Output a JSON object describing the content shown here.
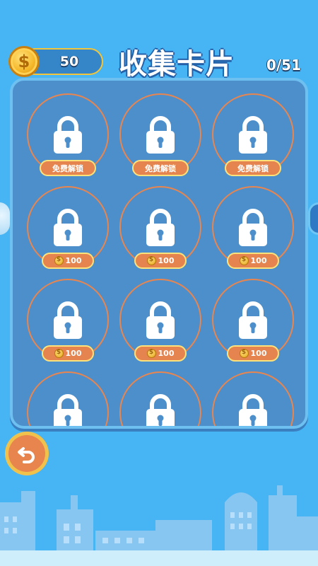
{
  "header": {
    "coins": "50",
    "coin_icon": "dollar-coin-icon",
    "title": "收集卡片",
    "progress": "0/51"
  },
  "cards": [
    {
      "locked": true,
      "badge": "免费解锁",
      "badge_type": "free"
    },
    {
      "locked": true,
      "badge": "免费解锁",
      "badge_type": "free"
    },
    {
      "locked": true,
      "badge": "免费解锁",
      "badge_type": "free"
    },
    {
      "locked": true,
      "badge": "100",
      "badge_type": "price"
    },
    {
      "locked": true,
      "badge": "100",
      "badge_type": "price"
    },
    {
      "locked": true,
      "badge": "100",
      "badge_type": "price"
    },
    {
      "locked": true,
      "badge": "100",
      "badge_type": "price"
    },
    {
      "locked": true,
      "badge": "100",
      "badge_type": "price"
    },
    {
      "locked": true,
      "badge": "100",
      "badge_type": "price"
    },
    {
      "locked": true,
      "badge": "",
      "badge_type": "hidden"
    },
    {
      "locked": true,
      "badge": "",
      "badge_type": "hidden"
    },
    {
      "locked": true,
      "badge": "",
      "badge_type": "hidden"
    }
  ],
  "colors": {
    "background": "#47b4f4",
    "panel": "#4d8fcb",
    "badge": "#e5844f",
    "badge_border": "#ffe37a",
    "ring": "#e9854e",
    "coin": "#f5b82a"
  },
  "icons": {
    "lock": "lock-icon",
    "back": "undo-arrow-icon",
    "left_nav": "left-arrow-icon",
    "right_nav": "right-arrow-icon"
  }
}
